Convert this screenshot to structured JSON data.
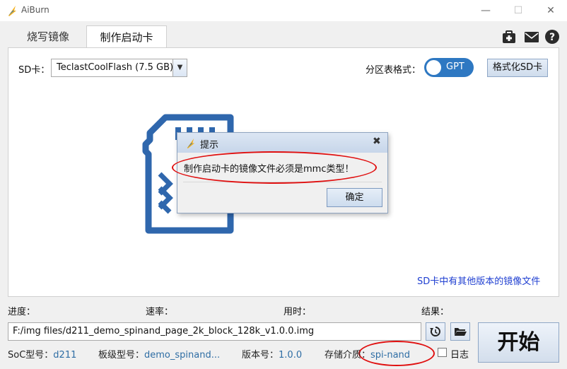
{
  "window": {
    "title": "AiBurn",
    "minimize_glyph": "—",
    "maximize_glyph": "☐",
    "close_glyph": "✕"
  },
  "tabs": [
    {
      "label": "烧写镜像",
      "active": false
    },
    {
      "label": "制作启动卡",
      "active": true
    }
  ],
  "toolbar_icons": [
    "first-aid-kit-icon",
    "mail-icon",
    "help-icon"
  ],
  "sd_card": {
    "label": "SD卡：",
    "selected": "TeclastCoolFlash (7.5 GB)",
    "arrow": "▼"
  },
  "partition": {
    "label": "分区表格式：",
    "toggle_value": "GPT"
  },
  "format_button": "格式化SD卡",
  "other_version_link": "SD卡中有其他版本的镜像文件",
  "dialog": {
    "title": "提示",
    "close_glyph": "✖",
    "message": "制作启动卡的镜像文件必须是mmc类型！",
    "ok_label": "确定"
  },
  "status": {
    "progress_label": "进度：",
    "speed_label": "速率：",
    "time_label": "用时：",
    "result_label": "结果："
  },
  "image_path": "F:/img files/d211_demo_spinand_page_2k_block_128k_v1.0.0.img",
  "start_button": "开始",
  "info": {
    "soc_key": "SoC型号：",
    "soc_val": "d211",
    "board_key": "板级型号：",
    "board_val": "demo_spinand...",
    "version_key": "版本号：",
    "version_val": "1.0.0",
    "storage_key": "存储介质：",
    "storage_val": "spi-nand"
  },
  "log_checkbox": {
    "label": "日志",
    "checked": false
  },
  "colors": {
    "accent": "#2e78c2",
    "link": "#1f3fd1",
    "annotation": "#e01010",
    "info_value": "#2e6da4"
  }
}
